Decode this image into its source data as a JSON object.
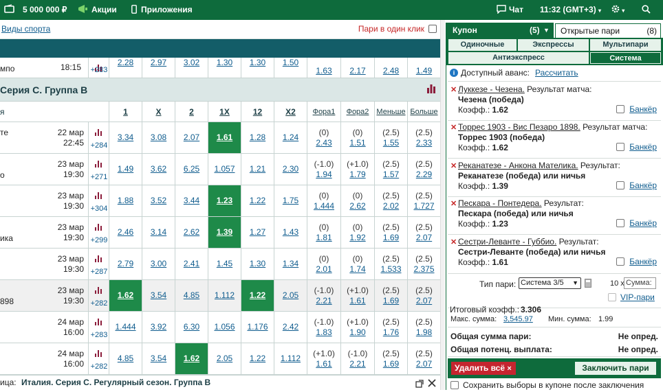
{
  "topbar": {
    "balance": "5 000 000 ₽",
    "promotions": "Акции",
    "apps": "Приложения",
    "chat": "Чат",
    "time": "11:32 (GMT+3)"
  },
  "subbar": {
    "sports_link": "Виды спорта",
    "one_click": "Пари в один клик"
  },
  "partial_row": {
    "team": "мпо",
    "date": "",
    "time": "18:15",
    "more": "+283",
    "odds": [
      "2.28",
      "2.97",
      "3.02",
      "1.30",
      "1.30",
      "1.50"
    ],
    "handicaps": [
      {
        "p": "",
        "v": "1.63"
      },
      {
        "p": "",
        "v": "2.17"
      },
      {
        "p": "",
        "v": "2.48"
      },
      {
        "p": "",
        "v": "1.49"
      }
    ]
  },
  "group": {
    "title": "Серия С. Группа В"
  },
  "columns": {
    "event": "я",
    "c1": "1",
    "cx": "X",
    "c2": "2",
    "c1x": "1X",
    "c12": "12",
    "cx2": "X2",
    "fora1": "Фора1",
    "fora2": "Фора2",
    "under": "Меньше",
    "over": "Больше"
  },
  "matches": [
    {
      "team": "те",
      "date": "22 мар",
      "time": "22:45",
      "more": "+284",
      "odds": [
        "3.34",
        "3.08",
        "2.07",
        "1.61",
        "1.28",
        "1.24"
      ],
      "hl": [
        3
      ],
      "fora1": {
        "p": "(0)",
        "v": "2.43"
      },
      "fora2": {
        "p": "(0)",
        "v": "1.51"
      },
      "under": {
        "p": "(2.5)",
        "v": "1.55"
      },
      "over": {
        "p": "(2.5)",
        "v": "2.33"
      }
    },
    {
      "team": "о",
      "date": "23 мар",
      "time": "19:30",
      "more": "+271",
      "odds": [
        "1.49",
        "3.62",
        "6.25",
        "1.057",
        "1.21",
        "2.30"
      ],
      "hl": [],
      "fora1": {
        "p": "(-1.0)",
        "v": "1.94"
      },
      "fora2": {
        "p": "(+1.0)",
        "v": "1.79"
      },
      "under": {
        "p": "(2.5)",
        "v": "1.57"
      },
      "over": {
        "p": "(2.5)",
        "v": "2.29"
      }
    },
    {
      "team": "",
      "date": "23 мар",
      "time": "19:30",
      "more": "+304",
      "odds": [
        "1.88",
        "3.52",
        "3.44",
        "1.23",
        "1.22",
        "1.75"
      ],
      "hl": [
        3
      ],
      "fora1": {
        "p": "(0)",
        "v": "1.444"
      },
      "fora2": {
        "p": "(0)",
        "v": "2.62"
      },
      "under": {
        "p": "(2.5)",
        "v": "2.02"
      },
      "over": {
        "p": "(2.5)",
        "v": "1.727"
      }
    },
    {
      "team": "ика",
      "date": "23 мар",
      "time": "19:30",
      "more": "+299",
      "odds": [
        "2.46",
        "3.14",
        "2.62",
        "1.39",
        "1.27",
        "1.43"
      ],
      "hl": [
        3
      ],
      "fora1": {
        "p": "(0)",
        "v": "1.81"
      },
      "fora2": {
        "p": "(0)",
        "v": "1.92"
      },
      "under": {
        "p": "(2.5)",
        "v": "1.69"
      },
      "over": {
        "p": "(2.5)",
        "v": "2.07"
      }
    },
    {
      "team": "",
      "date": "23 мар",
      "time": "19:30",
      "more": "+287",
      "odds": [
        "2.79",
        "3.00",
        "2.41",
        "1.45",
        "1.30",
        "1.34"
      ],
      "hl": [],
      "fora1": {
        "p": "(0)",
        "v": "2.01"
      },
      "fora2": {
        "p": "(0)",
        "v": "1.74"
      },
      "under": {
        "p": "(2.5)",
        "v": "1.533"
      },
      "over": {
        "p": "(2.5)",
        "v": "2.375"
      }
    },
    {
      "team": "898",
      "date": "23 мар",
      "time": "19:30",
      "more": "+282",
      "odds": [
        "1.62",
        "3.54",
        "4.85",
        "1.112",
        "1.22",
        "2.05"
      ],
      "hl": [
        0,
        4
      ],
      "fora1": {
        "p": "(-1.0)",
        "v": "2.21"
      },
      "fora2": {
        "p": "(+1.0)",
        "v": "1.61"
      },
      "under": {
        "p": "(2.5)",
        "v": "1.69"
      },
      "over": {
        "p": "(2.5)",
        "v": "2.07"
      }
    },
    {
      "team": "",
      "date": "24 мар",
      "time": "16:00",
      "more": "+283",
      "odds": [
        "1.444",
        "3.92",
        "6.30",
        "1.056",
        "1.176",
        "2.42"
      ],
      "hl": [],
      "fora1": {
        "p": "(-1.0)",
        "v": "1.83"
      },
      "fora2": {
        "p": "(+1.0)",
        "v": "1.90"
      },
      "under": {
        "p": "(2.5)",
        "v": "1.76"
      },
      "over": {
        "p": "(2.5)",
        "v": "1.98"
      }
    },
    {
      "team": "",
      "date": "24 мар",
      "time": "16:00",
      "more": "+282",
      "odds": [
        "4.85",
        "3.54",
        "1.62",
        "2.05",
        "1.22",
        "1.112"
      ],
      "hl": [
        2
      ],
      "fora1": {
        "p": "(+1.0)",
        "v": "1.61"
      },
      "fora2": {
        "p": "(-1.0)",
        "v": "2.21"
      },
      "under": {
        "p": "(2.5)",
        "v": "1.69"
      },
      "over": {
        "p": "(2.5)",
        "v": "2.07"
      }
    }
  ],
  "bottombar": {
    "prefix": "ица:",
    "league": "Италия. Серия С. Регулярный сезон. Группа В"
  },
  "coupon": {
    "tab_coupon": "Купон",
    "coupon_count": "(5)",
    "tab_open": "Открытые пари",
    "open_count": "(8)",
    "types": [
      "Одиночные",
      "Экспрессы",
      "Мультипари",
      "Антиэкспресс",
      "Система"
    ],
    "advance_label": "Доступный аванс:",
    "advance_link": "Рассчитать",
    "bets": [
      {
        "event": "Луккезе - Чезена.",
        "market": " Результат матча:",
        "selection": "Чезена (победа)",
        "coef_label": "Коэфф.:",
        "coef": "1.62",
        "banker": "Банкёр"
      },
      {
        "event": "Торрес 1903 - Вис Пезаро 1898.",
        "market": " Результат матча:",
        "selection": "Торрес 1903 (победа)",
        "coef_label": "Коэфф.:",
        "coef": "1.62",
        "banker": "Банкёр"
      },
      {
        "event": "Реканатезе - Анкона Мателика.",
        "market": " Результат:",
        "selection": "Реканатезе (победа) или ничья",
        "coef_label": "Коэфф.:",
        "coef": "1.39",
        "banker": "Банкёр"
      },
      {
        "event": "Пескара - Понтедера.",
        "market": " Результат:",
        "selection": "Пескара (победа) или ничья",
        "coef_label": "Коэфф.:",
        "coef": "1.23",
        "banker": "Банкёр"
      },
      {
        "event": "Сестри-Леванте - Губбио.",
        "market": " Результат:",
        "selection": "Сестри-Леванте (победа) или ничья",
        "coef_label": "Коэфф.:",
        "coef": "1.61",
        "banker": "Банкёр"
      }
    ],
    "type_label": "Тип пари:",
    "type_value": "Система 3/5",
    "multiplier": "10 x",
    "sum_placeholder": "Сумма:",
    "vip": "VIP-пари",
    "total_coef_label": "Итоговый коэфф.:",
    "total_coef": "3.306",
    "max_label": "Макс. сумма:",
    "max_value": "3,545.97",
    "min_label": "Мин. сумма:",
    "min_value": "1.99",
    "total_sum_label": "Общая сумма пари:",
    "total_sum_value": "Не опред.",
    "payout_label": "Общая потенц. выплата:",
    "payout_value": "Не опред.",
    "delete_all": "Удалить всё",
    "place_bet": "Заключить пари",
    "save_choices": "Сохранить выборы в купоне после заключения"
  },
  "colors": {
    "brand": "#0e6b3c",
    "highlight": "#1e8a49",
    "teal": "#135d68",
    "link": "#0f5c8e",
    "danger": "#c52525"
  }
}
